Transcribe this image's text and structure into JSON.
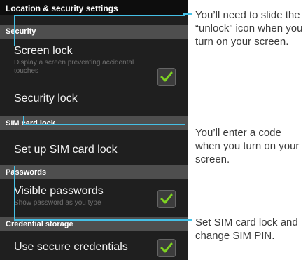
{
  "screen": {
    "title": "Location & security settings",
    "sections": {
      "security": "Security",
      "sim_card_lock": "SIM card lock",
      "passwords": "Passwords",
      "credential_storage": "Credential storage"
    },
    "items": {
      "screen_lock": {
        "title": "Screen lock",
        "summary": "Display a screen preventing accidental touches",
        "checked": true
      },
      "security_lock": {
        "title": "Security lock"
      },
      "sim_lock": {
        "title": "Set up SIM card lock"
      },
      "visible_passwords": {
        "title": "Visible passwords",
        "summary": "Show password as you type",
        "checked": true
      },
      "secure_credentials": {
        "title": "Use secure credentials",
        "checked": true
      }
    }
  },
  "callouts": {
    "unlock": "You’ll need to slide the “unlock” icon when you turn on your screen.",
    "code": "You’ll enter a code when you turn on your screen.",
    "sim": "Set SIM card lock and change SIM PIN."
  },
  "colors": {
    "checkmark": "#7ed321",
    "callout_line": "#45c0e6"
  }
}
